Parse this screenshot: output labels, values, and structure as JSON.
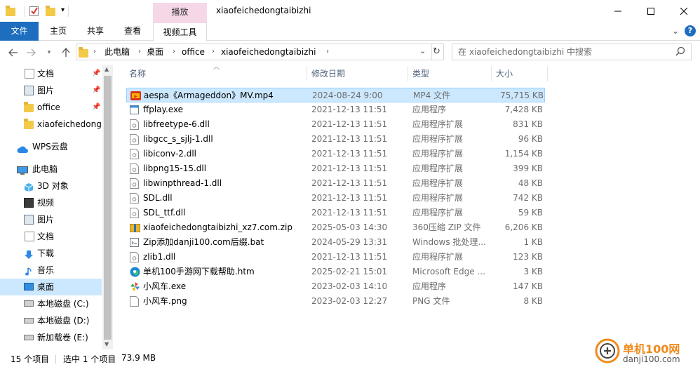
{
  "window": {
    "title": "xiaofeichedongtaibizhi",
    "contextual_tab": "播放",
    "controls": [
      "minimize-icon",
      "maximize-icon",
      "close-icon"
    ]
  },
  "ribbon": {
    "tabs": [
      "文件",
      "主页",
      "共享",
      "查看",
      "视频工具"
    ]
  },
  "address": {
    "crumbs": [
      "此电脑",
      "桌面",
      "office",
      "xiaofeichedongtaibizhi"
    ],
    "search_placeholder": "在 xiaofeichedongtaibizhi 中搜索"
  },
  "sidebar": {
    "quick_access": [
      {
        "label": "文档",
        "icon": "document-icon",
        "pinned": true
      },
      {
        "label": "图片",
        "icon": "pictures-icon",
        "pinned": true
      },
      {
        "label": "office",
        "icon": "folder-icon",
        "pinned": true
      },
      {
        "label": "xiaofeichedongtaibizhi",
        "icon": "folder-icon",
        "pinned": false
      }
    ],
    "wps": "WPS云盘",
    "this_pc": "此电脑",
    "pc_items": [
      {
        "label": "3D 对象",
        "icon": "3d-objects-icon"
      },
      {
        "label": "视频",
        "icon": "video-icon"
      },
      {
        "label": "图片",
        "icon": "pictures-icon"
      },
      {
        "label": "文档",
        "icon": "document-icon"
      },
      {
        "label": "下载",
        "icon": "download-icon"
      },
      {
        "label": "音乐",
        "icon": "music-icon"
      },
      {
        "label": "桌面",
        "icon": "desktop-icon",
        "selected": true
      },
      {
        "label": "本地磁盘 (C:)",
        "icon": "drive-c-icon"
      },
      {
        "label": "本地磁盘 (D:)",
        "icon": "drive-icon"
      },
      {
        "label": "新加载卷 (E:)",
        "icon": "drive-icon"
      }
    ]
  },
  "columns": {
    "name": "名称",
    "date": "修改日期",
    "type": "类型",
    "size": "大小"
  },
  "files": [
    {
      "name": "aespa《Armageddon》MV.mp4",
      "date": "2024-08-24 9:00",
      "type": "MP4 文件",
      "size": "75,715 KB",
      "icon": "mp4-icon",
      "selected": true
    },
    {
      "name": "ffplay.exe",
      "date": "2021-12-13 11:51",
      "type": "应用程序",
      "size": "7,428 KB",
      "icon": "exe-icon"
    },
    {
      "name": "libfreetype-6.dll",
      "date": "2021-12-13 11:51",
      "type": "应用程序扩展",
      "size": "831 KB",
      "icon": "dll-icon"
    },
    {
      "name": "libgcc_s_sjlj-1.dll",
      "date": "2021-12-13 11:51",
      "type": "应用程序扩展",
      "size": "96 KB",
      "icon": "dll-icon"
    },
    {
      "name": "libiconv-2.dll",
      "date": "2021-12-13 11:51",
      "type": "应用程序扩展",
      "size": "1,154 KB",
      "icon": "dll-icon"
    },
    {
      "name": "libpng15-15.dll",
      "date": "2021-12-13 11:51",
      "type": "应用程序扩展",
      "size": "399 KB",
      "icon": "dll-icon"
    },
    {
      "name": "libwinpthread-1.dll",
      "date": "2021-12-13 11:51",
      "type": "应用程序扩展",
      "size": "48 KB",
      "icon": "dll-icon"
    },
    {
      "name": "SDL.dll",
      "date": "2021-12-13 11:51",
      "type": "应用程序扩展",
      "size": "742 KB",
      "icon": "dll-icon"
    },
    {
      "name": "SDL_ttf.dll",
      "date": "2021-12-13 11:51",
      "type": "应用程序扩展",
      "size": "59 KB",
      "icon": "dll-icon"
    },
    {
      "name": "xiaofeichedongtaibizhi_xz7.com.zip",
      "date": "2025-05-03 14:30",
      "type": "360压缩 ZIP 文件",
      "size": "6,206 KB",
      "icon": "zip-icon"
    },
    {
      "name": "Zip添加danji100.com后缀.bat",
      "date": "2024-05-29 13:31",
      "type": "Windows 批处理...",
      "size": "1 KB",
      "icon": "bat-icon"
    },
    {
      "name": "zlib1.dll",
      "date": "2021-12-13 11:51",
      "type": "应用程序扩展",
      "size": "123 KB",
      "icon": "dll-icon"
    },
    {
      "name": "单机100手游网下载帮助.htm",
      "date": "2025-02-21 15:01",
      "type": "Microsoft Edge ...",
      "size": "3 KB",
      "icon": "edge-icon"
    },
    {
      "name": "小风车.exe",
      "date": "2023-02-03 14:10",
      "type": "应用程序",
      "size": "147 KB",
      "icon": "pinwheel-icon"
    },
    {
      "name": "小风车.png",
      "date": "2023-02-03 12:27",
      "type": "PNG 文件",
      "size": "8 KB",
      "icon": "png-icon"
    }
  ],
  "status": {
    "count": "15 个项目",
    "selected": "选中 1 个项目",
    "size": "73.9 MB"
  },
  "watermark": {
    "brand": "单机100网",
    "url": "danji100.com"
  },
  "colors": {
    "accent": "#1e6ec0",
    "selection": "#cce8ff",
    "contextual": "#f6d7e8"
  }
}
